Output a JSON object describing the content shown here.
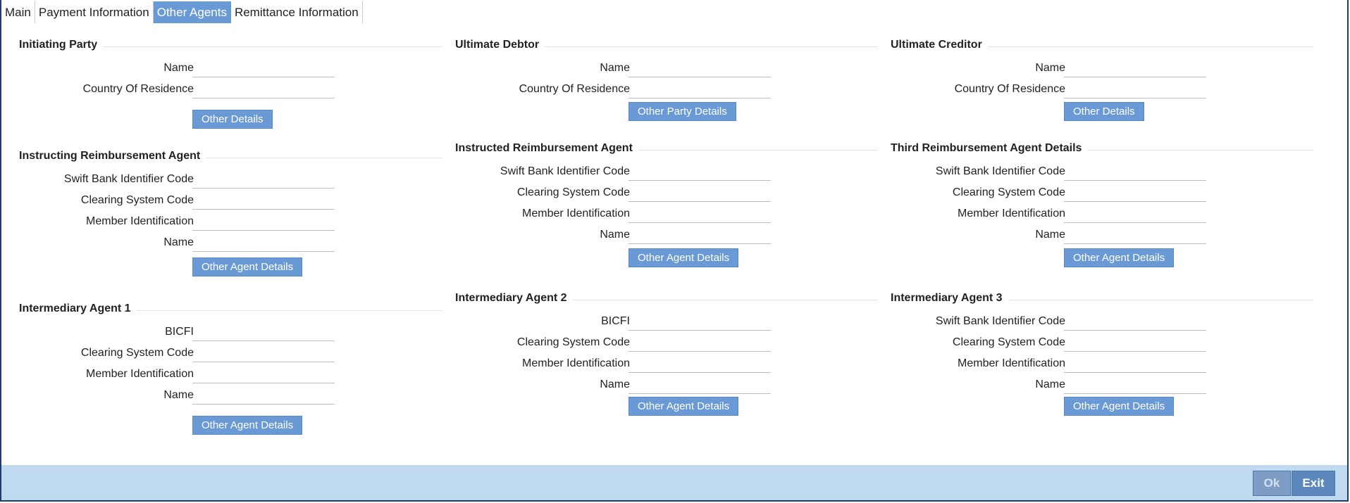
{
  "tabs": [
    "Main",
    "Payment Information",
    "Other Agents",
    "Remittance Information"
  ],
  "active_tab": "Other Agents",
  "col1": {
    "initiating_party": {
      "title": "Initiating Party",
      "name_label": "Name",
      "country_label": "Country Of Residence",
      "button": "Other Details"
    },
    "instructing_reimbursement_agent": {
      "title": "Instructing Reimbursement Agent",
      "swift_label": "Swift Bank Identifier Code",
      "clearing_label": "Clearing System Code",
      "member_label": "Member Identification",
      "name_label": "Name",
      "button": "Other Agent Details"
    },
    "intermediary_agent_1": {
      "title": "Intermediary Agent 1",
      "bicfi_label": "BICFI",
      "clearing_label": "Clearing System Code",
      "member_label": "Member Identification",
      "name_label": "Name",
      "button": "Other Agent Details"
    }
  },
  "col2": {
    "ultimate_debtor": {
      "title": "Ultimate Debtor",
      "name_label": "Name",
      "country_label": "Country Of Residence",
      "button": "Other Party Details"
    },
    "instructed_reimbursement_agent": {
      "title": "Instructed Reimbursement Agent",
      "swift_label": "Swift Bank Identifier Code",
      "clearing_label": "Clearing System Code",
      "member_label": "Member Identification",
      "name_label": "Name",
      "button": "Other Agent Details"
    },
    "intermediary_agent_2": {
      "title": "Intermediary Agent 2",
      "bicfi_label": "BICFI",
      "clearing_label": "Clearing System Code",
      "member_label": "Member Identification",
      "name_label": "Name",
      "button": "Other Agent Details"
    }
  },
  "col3": {
    "ultimate_creditor": {
      "title": "Ultimate Creditor",
      "name_label": "Name",
      "country_label": "Country Of Residence",
      "button": "Other Details"
    },
    "third_reimbursement_agent": {
      "title": "Third Reimbursement Agent Details",
      "swift_label": "Swift Bank Identifier Code",
      "clearing_label": "Clearing System Code",
      "member_label": "Member Identification",
      "name_label": "Name",
      "button": "Other Agent Details"
    },
    "intermediary_agent_3": {
      "title": "Intermediary Agent 3",
      "swift_label": "Swift Bank Identifier Code",
      "clearing_label": "Clearing System Code",
      "member_label": "Member Identification",
      "name_label": "Name",
      "button": "Other Agent Details"
    }
  },
  "footer": {
    "ok": "Ok",
    "exit": "Exit"
  },
  "colors": {
    "accent": "#6a9ad6",
    "footer_bg": "#bfd9ee",
    "frame": "#1f3b6e"
  }
}
